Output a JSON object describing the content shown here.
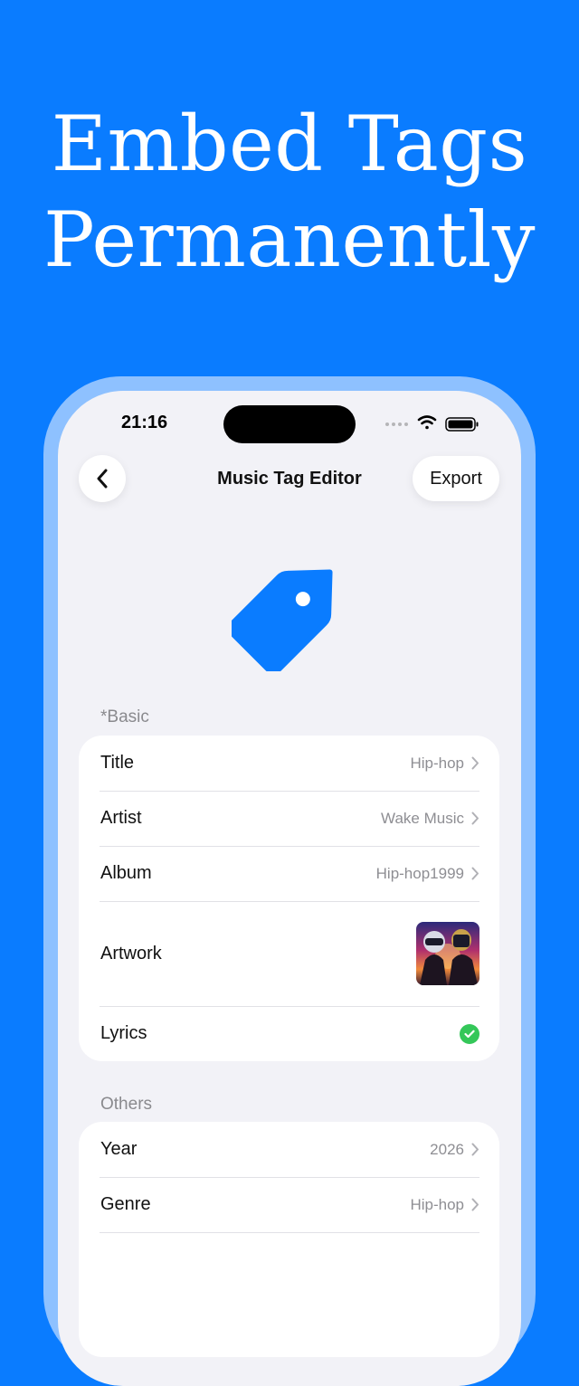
{
  "headline": {
    "line1": "Embed Tags",
    "line2": "Permanently"
  },
  "status_bar": {
    "time": "21:16"
  },
  "nav": {
    "title": "Music Tag Editor",
    "export_label": "Export"
  },
  "sections": {
    "basic": {
      "label": "*Basic",
      "rows": [
        {
          "label": "Title",
          "value": "Hip-hop"
        },
        {
          "label": "Artist",
          "value": "Wake Music"
        },
        {
          "label": "Album",
          "value": "Hip-hop1999"
        },
        {
          "label": "Artwork"
        },
        {
          "label": "Lyrics"
        }
      ]
    },
    "others": {
      "label": "Others",
      "rows": [
        {
          "label": "Year",
          "value": "2026"
        },
        {
          "label": "Genre",
          "value": "Hip-hop"
        }
      ]
    }
  },
  "colors": {
    "accent": "#0a7cff",
    "success": "#34c759",
    "background": "#f2f2f7"
  },
  "icons": [
    "back-chevron-icon",
    "tag-icon",
    "chevron-right-icon",
    "checkmark-icon",
    "wifi-icon",
    "battery-icon",
    "signal-icon"
  ]
}
